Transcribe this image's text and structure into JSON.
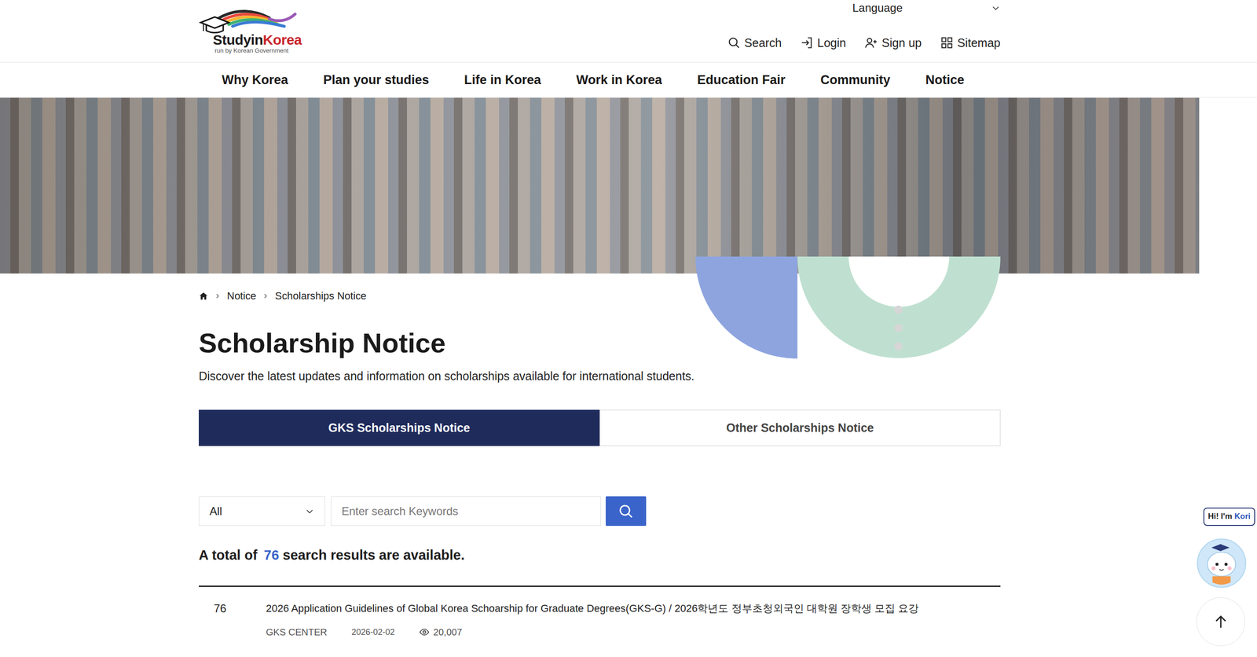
{
  "header": {
    "logo": {
      "brand_first": "Studyin",
      "brand_second": "Korea",
      "tagline": "run by Korean Government"
    },
    "language": "Language",
    "utility_links": [
      {
        "label": "Search",
        "kind": "search"
      },
      {
        "label": "Login",
        "kind": "login"
      },
      {
        "label": "Sign up",
        "kind": "signup"
      },
      {
        "label": "Sitemap",
        "kind": "sitemap"
      }
    ]
  },
  "nav": [
    "Why Korea",
    "Plan your studies",
    "Life in Korea",
    "Work in Korea",
    "Education Fair",
    "Community",
    "Notice"
  ],
  "breadcrumb": [
    "Notice",
    "Scholarships Notice"
  ],
  "page": {
    "title": "Scholarship Notice",
    "description": "Discover the latest updates and information on scholarships available for international students."
  },
  "tabs": [
    {
      "label": "GKS Scholarships Notice",
      "selected": true
    },
    {
      "label": "Other Scholarships Notice",
      "selected": false
    }
  ],
  "search": {
    "category": "All",
    "placeholder": "Enter search Keywords"
  },
  "results": {
    "prefix": "A total of",
    "count": "76",
    "suffix": "search results are available."
  },
  "rows": [
    {
      "number": "76",
      "title": "2026 Application Guidelines of Global Korea Schoarship for Graduate Degrees(GKS-G) / 2026학년도 정부초청외국인 대학원 장학생 모집 요강",
      "author": "GKS CENTER",
      "date": "2026-02-02",
      "views": "20,007"
    }
  ],
  "chatbot": {
    "greeting": "Hi! I'm",
    "name": "Kori"
  }
}
